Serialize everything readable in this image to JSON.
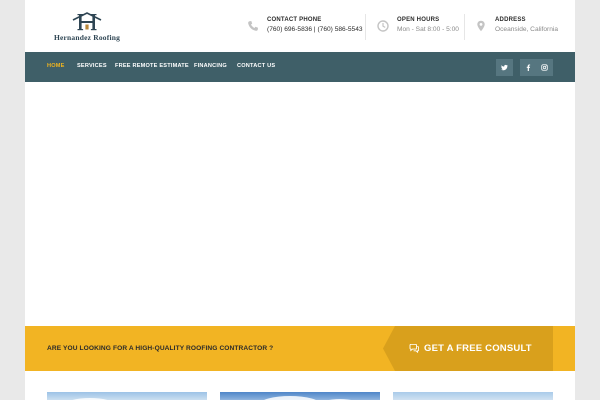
{
  "brand": {
    "name": "Hernandez Roofing",
    "monogram": "H"
  },
  "contact": [
    {
      "label": "CONTACT PHONE",
      "value": "(760) 696-5836 | (760) 586-5543",
      "icon": "phone-icon"
    },
    {
      "label": "OPEN HOURS",
      "value": "Mon - Sat 8:00 - 5:00",
      "icon": "clock-icon"
    },
    {
      "label": "ADDRESS",
      "value": "Oceanside, California",
      "icon": "map-pin-icon"
    }
  ],
  "nav": {
    "items": [
      {
        "label": "HOME",
        "active": true
      },
      {
        "label": "SERVICES"
      },
      {
        "label": "FREE REMOTE ESTIMATE"
      },
      {
        "label": "FINANCING"
      },
      {
        "label": "CONTACT US"
      }
    ],
    "social": [
      {
        "icon": "twitter-icon"
      },
      {
        "icon": "facebook-icon"
      },
      {
        "icon": "instagram-icon"
      }
    ]
  },
  "cta": {
    "question": "ARE YOU LOOKING FOR A HIGH-QUALITY ROOFING CONTRACTOR ?",
    "button_label": "GET A FREE CONSULT",
    "button_icon": "chat-bubbles-icon"
  },
  "colors": {
    "nav_bg": "#3f5f68",
    "accent": "#f2b423",
    "accent_dark": "#d9a01c",
    "active_link": "#f0b51f",
    "logo": "#2f4654"
  }
}
